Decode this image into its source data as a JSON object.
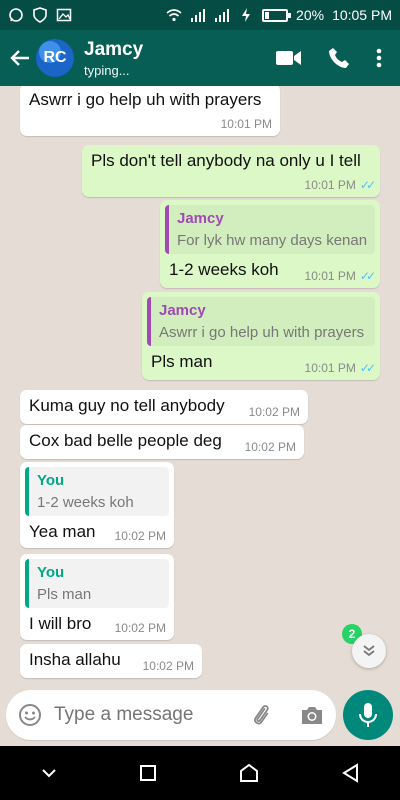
{
  "statusbar": {
    "battery": "20%",
    "battery_fraction": 0.2,
    "time": "10:05 PM"
  },
  "header": {
    "back_icon": "arrow-left-icon",
    "avatar_text": "RC",
    "name": "Jamcy",
    "status": "typing..."
  },
  "messages": [
    {
      "dir": "in",
      "text": "Aswrr i go help uh with prayers",
      "time": "10:01 PM"
    },
    {
      "dir": "out",
      "text": "Pls don't tell anybody na only u I tell",
      "time": "10:01 PM"
    },
    {
      "dir": "out",
      "quote_name": "Jamcy",
      "quote_text": "For lyk hw many days kenan",
      "text": "1-2 weeks koh",
      "time": "10:01 PM"
    },
    {
      "dir": "out",
      "quote_name": "Jamcy",
      "quote_text": "Aswrr i go help uh with prayers",
      "text": "Pls man",
      "time": "10:01 PM"
    },
    {
      "dir": "in",
      "text": "Kuma guy no tell anybody",
      "time": "10:02 PM"
    },
    {
      "dir": "in",
      "text": "Cox bad belle people deg",
      "time": "10:02 PM"
    },
    {
      "dir": "in",
      "quote_name": "You",
      "quote_text": "1-2 weeks koh",
      "text": "Yea man",
      "time": "10:02 PM"
    },
    {
      "dir": "in",
      "quote_name": "You",
      "quote_text": "Pls man",
      "text": "I will bro",
      "time": "10:02 PM"
    },
    {
      "dir": "in",
      "text": "Insha allahu",
      "time": "10:02 PM"
    }
  ],
  "scroll": {
    "unread_count": "2"
  },
  "composer": {
    "placeholder": "Type a message"
  },
  "colors": {
    "header": "#075e54",
    "statusbar": "#054d44",
    "outgoing": "#dcf8c6",
    "incoming": "#ffffff",
    "accent": "#00897b",
    "read_ticks": "#4fc3f7"
  }
}
